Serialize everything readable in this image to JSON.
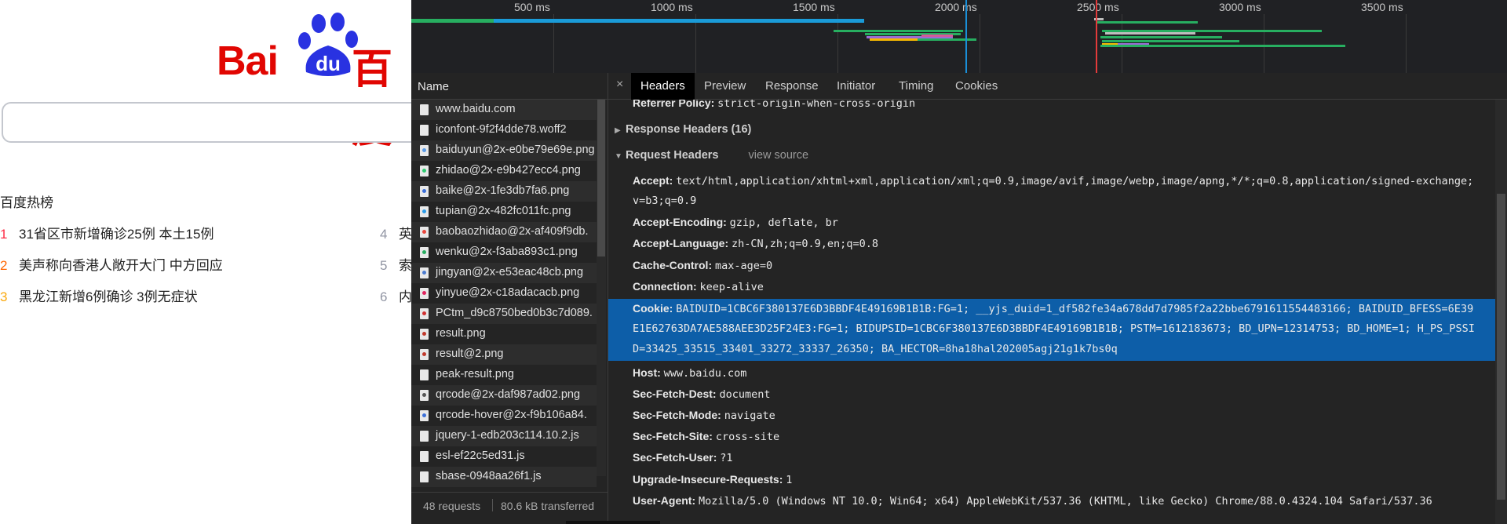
{
  "baidu": {
    "logo_text_latin": "Bai",
    "logo_text_du": "du",
    "logo_text_cn": "百度",
    "hot_title": "百度热榜",
    "hot_items": [
      {
        "rank": "1",
        "text": "31省区市新增确诊25例 本土15例"
      },
      {
        "rank": "2",
        "text": "美声称向香港人敞开大门 中方回应"
      },
      {
        "rank": "3",
        "text": "黑龙江新增6例确诊 3例无症状"
      },
      {
        "rank": "4",
        "text": "英"
      },
      {
        "rank": "5",
        "text": "索"
      },
      {
        "rank": "6",
        "text": "内"
      }
    ]
  },
  "timeline": {
    "ticks": [
      "500 ms",
      "1000 ms",
      "1500 ms",
      "2000 ms",
      "2500 ms",
      "3000 ms",
      "3500 ms"
    ]
  },
  "network": {
    "name_header": "Name",
    "files": [
      {
        "name": "www.baidu.com",
        "type": "doc"
      },
      {
        "name": "iconfont-9f2f4dde78.woff2",
        "type": "doc"
      },
      {
        "name": "baiduyun@2x-e0be79e69e.png",
        "type": "img",
        "color": "#5a9be6"
      },
      {
        "name": "zhidao@2x-e9b427ecc4.png",
        "type": "img",
        "color": "#2ecc71"
      },
      {
        "name": "baike@2x-1fe3db7fa6.png",
        "type": "img",
        "color": "#3b6fd8"
      },
      {
        "name": "tupian@2x-482fc011fc.png",
        "type": "img",
        "color": "#2a9be8"
      },
      {
        "name": "baobaozhidao@2x-af409f9db.",
        "type": "img",
        "color": "#e8463c"
      },
      {
        "name": "wenku@2x-f3aba893c1.png",
        "type": "img",
        "color": "#27ae60"
      },
      {
        "name": "jingyan@2x-e53eac48cb.png",
        "type": "img",
        "color": "#4a7bd0"
      },
      {
        "name": "yinyue@2x-c18adacacb.png",
        "type": "img",
        "color": "#e0245e"
      },
      {
        "name": "PCtm_d9c8750bed0b3c7d089.",
        "type": "img",
        "color": "#d03030"
      },
      {
        "name": "result.png",
        "type": "img",
        "color": "#c0392b"
      },
      {
        "name": "result@2.png",
        "type": "img",
        "color": "#c0392b"
      },
      {
        "name": "peak-result.png",
        "type": "doc"
      },
      {
        "name": "qrcode@2x-daf987ad02.png",
        "type": "img",
        "color": "#555555"
      },
      {
        "name": "qrcode-hover@2x-f9b106a84.",
        "type": "img",
        "color": "#3b6fd8"
      },
      {
        "name": "jquery-1-edb203c114.10.2.js",
        "type": "doc"
      },
      {
        "name": "esl-ef22c5ed31.js",
        "type": "doc"
      },
      {
        "name": "sbase-0948aa26f1.js",
        "type": "doc"
      }
    ],
    "requests": "48 requests",
    "transferred": "80.6 kB transferred"
  },
  "details": {
    "close_glyph": "×",
    "tabs": [
      "Headers",
      "Preview",
      "Response",
      "Initiator",
      "Timing",
      "Cookies"
    ],
    "active_tab": "Headers",
    "referrer_key": "Referrer Policy:",
    "referrer_val": "strict-origin-when-cross-origin",
    "response_headers_title": "Response Headers (16)",
    "request_headers_title": "Request Headers",
    "view_source": "view source",
    "accept_key": "Accept:",
    "accept_val_1": "text/html,application/xhtml+xml,application/xml;q=0.9,image/avif,image/webp,image/apng,*/*;q=0.8,application/signed-exchange;",
    "accept_val_2": "v=b3;q=0.9",
    "encoding_key": "Accept-Encoding:",
    "encoding_val": "gzip, deflate, br",
    "language_key": "Accept-Language:",
    "language_val": "zh-CN,zh;q=0.9,en;q=0.8",
    "cache_key": "Cache-Control:",
    "cache_val": "max-age=0",
    "connection_key": "Connection:",
    "connection_val": "keep-alive",
    "cookie_key": "Cookie:",
    "cookie_val_1": "BAIDUID=1CBC6F380137E6D3BBDF4E49169B1B1B:FG=1; __yjs_duid=1_df582fe34a678dd7d7985f2a22bbe6791611554483166; BAIDUID_BFESS=6E39",
    "cookie_val_2": "E1E62763DA7AE588AEE3D25F24E3:FG=1; BIDUPSID=1CBC6F380137E6D3BBDF4E49169B1B1B; PSTM=1612183673; BD_UPN=12314753; BD_HOME=1; H_PS_PSSI",
    "cookie_val_3": "D=33425_33515_33401_33272_33337_26350; BA_HECTOR=8ha18hal202005agj21g1k7bs0q",
    "host_key": "Host:",
    "host_val": "www.baidu.com",
    "dest_key": "Sec-Fetch-Dest:",
    "dest_val": "document",
    "mode_key": "Sec-Fetch-Mode:",
    "mode_val": "navigate",
    "site_key": "Sec-Fetch-Site:",
    "site_val": "cross-site",
    "user_key": "Sec-Fetch-User:",
    "user_val": "?1",
    "upgrade_key": "Upgrade-Insecure-Requests:",
    "upgrade_val": "1",
    "ua_key": "User-Agent:",
    "ua_val": "Mozilla/5.0 (Windows NT 10.0; Win64; x64) AppleWebKit/537.36 (KHTML, like Gecko) Chrome/88.0.4324.104 Safari/537.36"
  },
  "colors": {
    "selection": "#0d5ea8",
    "baidu_red": "#e10602",
    "baidu_blue": "#2932e1"
  }
}
